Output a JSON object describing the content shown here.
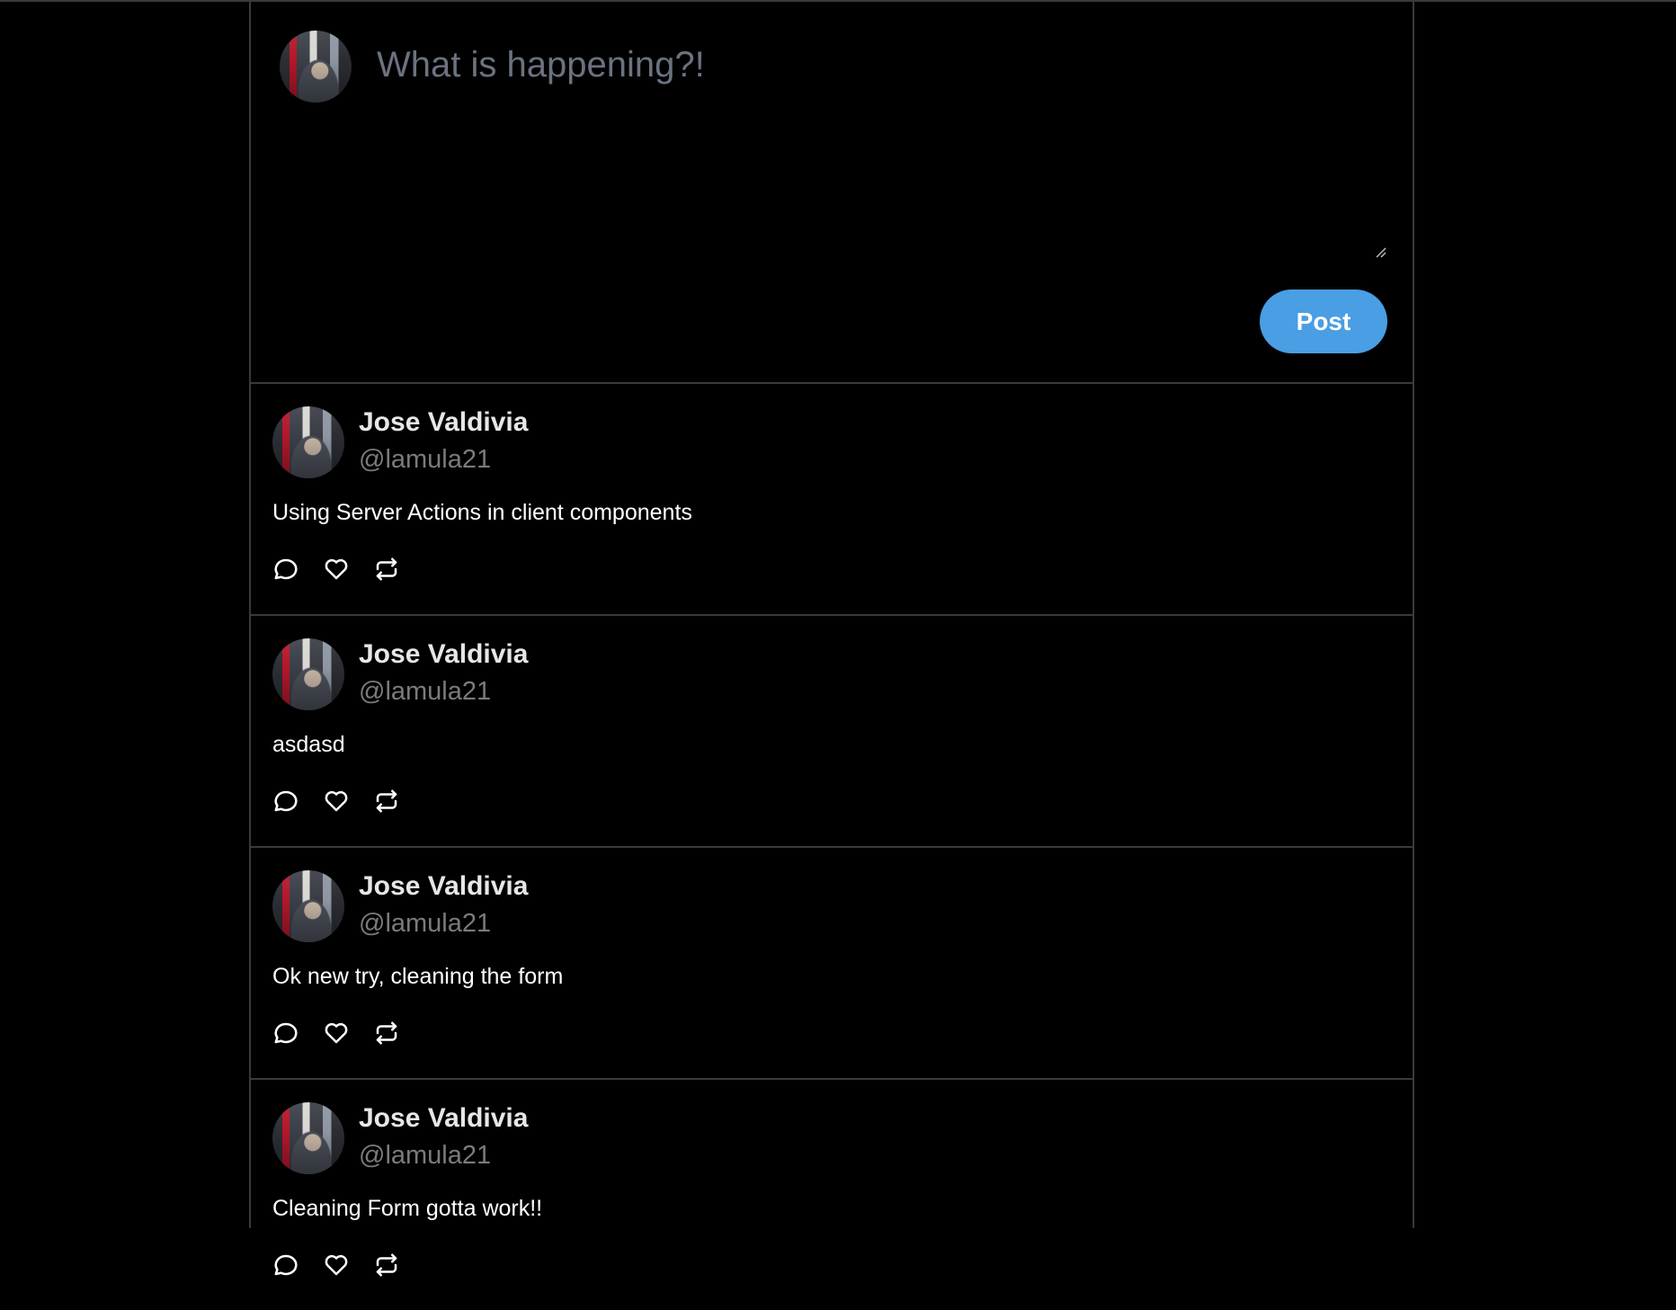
{
  "composer": {
    "placeholder": "What is happening?!",
    "value": "",
    "post_label": "Post",
    "avatar": "user-avatar"
  },
  "posts": [
    {
      "name": "Jose Valdivia",
      "handle": "@lamula21",
      "text": "Using Server Actions in client components",
      "actions": [
        "comment-icon",
        "heart-icon",
        "retweet-icon"
      ]
    },
    {
      "name": "Jose Valdivia",
      "handle": "@lamula21",
      "text": "asdasd",
      "actions": [
        "comment-icon",
        "heart-icon",
        "retweet-icon"
      ]
    },
    {
      "name": "Jose Valdivia",
      "handle": "@lamula21",
      "text": "Ok new try, cleaning the form",
      "actions": [
        "comment-icon",
        "heart-icon",
        "retweet-icon"
      ]
    },
    {
      "name": "Jose Valdivia",
      "handle": "@lamula21",
      "text": "Cleaning Form gotta work!!",
      "actions": [
        "comment-icon",
        "heart-icon",
        "retweet-icon"
      ]
    }
  ],
  "colors": {
    "background": "#000000",
    "border": "#3a3a3a",
    "accent": "#4a9ee3",
    "handle": "#7b7b7b",
    "placeholder": "#6b7280"
  }
}
